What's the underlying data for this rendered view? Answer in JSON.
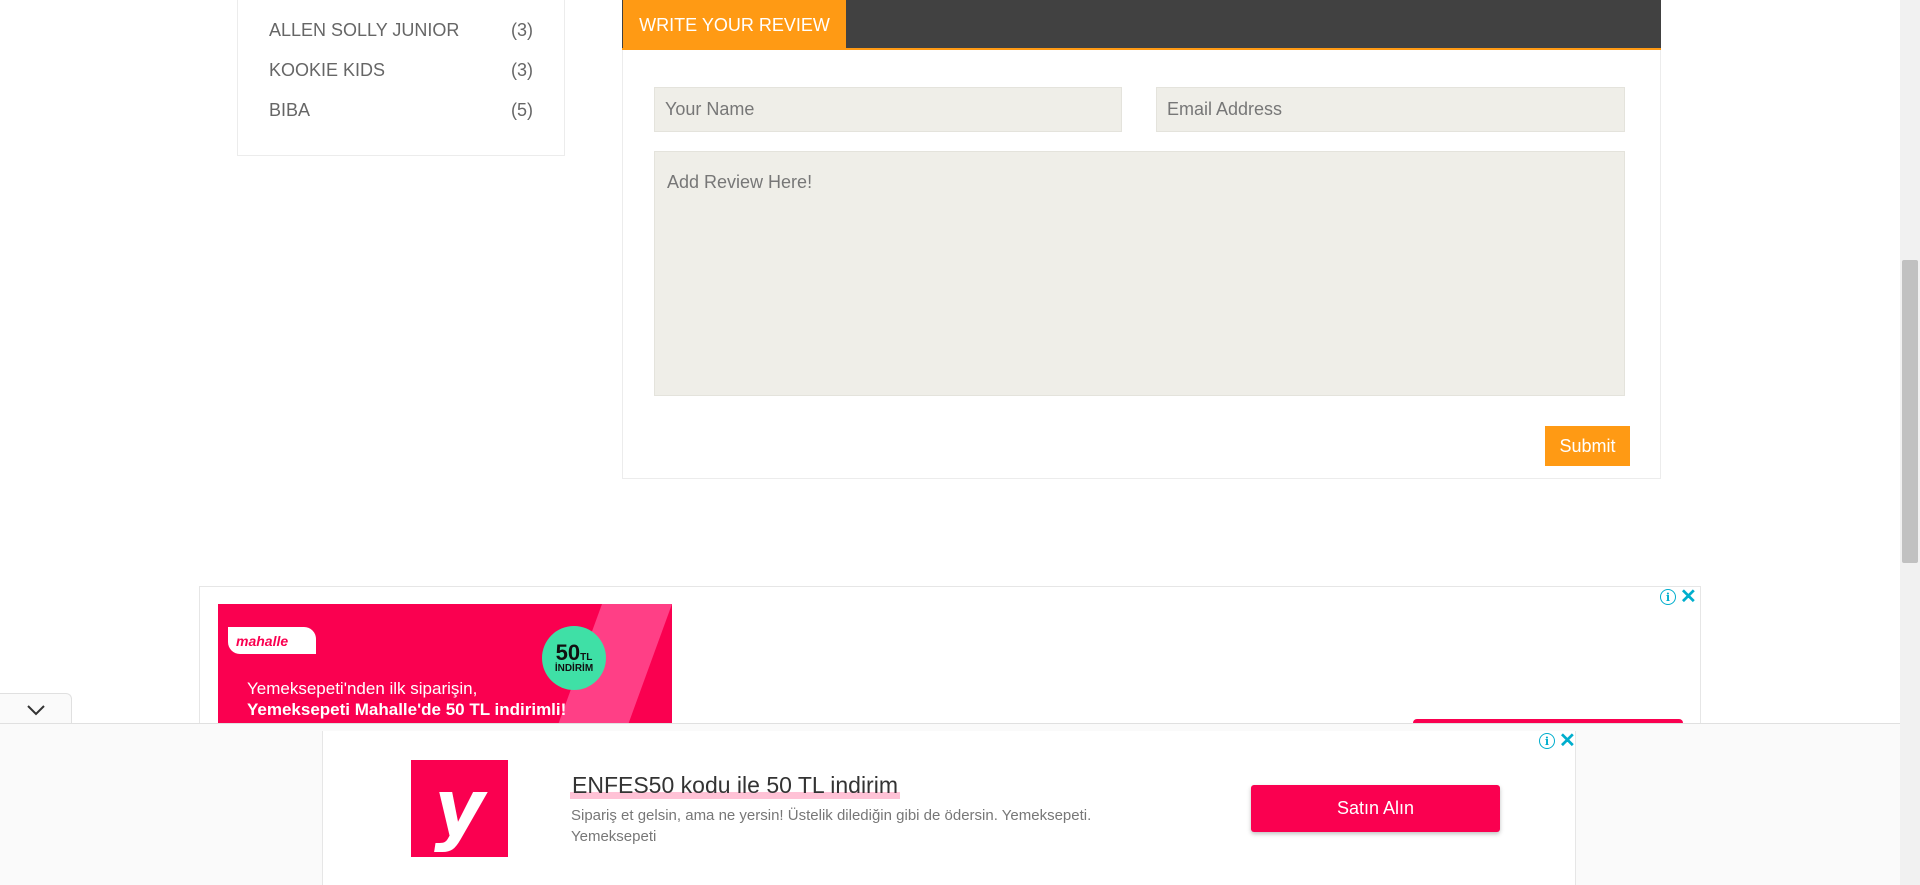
{
  "sidebar": {
    "brands": [
      {
        "name": "ALLEN SOLLY JUNIOR",
        "count": "(3)"
      },
      {
        "name": "KOOKIE KIDS",
        "count": "(3)"
      },
      {
        "name": "BIBA",
        "count": "(5)"
      }
    ]
  },
  "review": {
    "tab_label": "WRITE YOUR REVIEW",
    "name_placeholder": "Your Name",
    "email_placeholder": "Email Address",
    "review_placeholder": "Add Review Here!",
    "submit_label": "Submit"
  },
  "ad_top": {
    "logo_text": "mahalle",
    "badge_amount": "50",
    "badge_unit": "TL",
    "badge_label": "İNDİRİM",
    "line1": "Yemeksepeti'nden ilk siparişin,",
    "line2": "Yemeksepeti Mahalle'de 50 TL indirimli!"
  },
  "ad_bottom": {
    "logo_letter": "y",
    "title": "ENFES50 kodu ile 50 TL indirim",
    "description": "Sipariş et gelsin, ama ne yersin! Üstelik dilediğin gibi de ödersin. Yemeksepeti. Yemeksepeti",
    "cta_label": "Satın Alın"
  },
  "icons": {
    "info": "info-icon",
    "close": "close-icon",
    "collapse": "chevron-down-icon"
  },
  "colors": {
    "accent_orange": "#ff9a14",
    "header_dark": "#414141",
    "field_bg": "#efeee8",
    "brand_pink": "#fa0050",
    "badge_green": "#3fe0a6",
    "ad_icon_blue": "#00aecd"
  }
}
